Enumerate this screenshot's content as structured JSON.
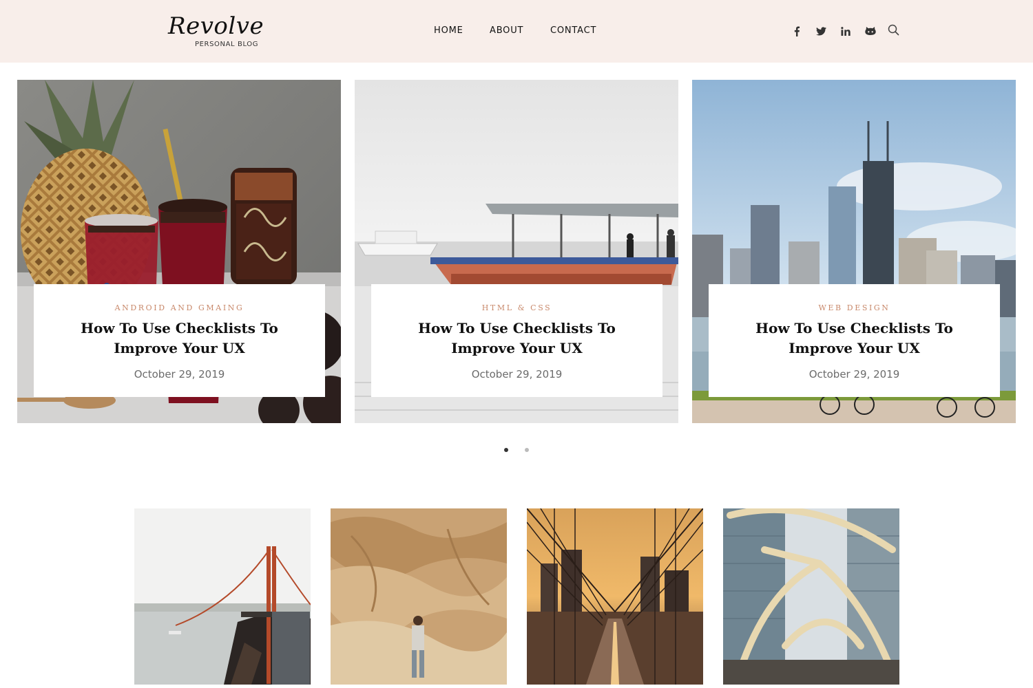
{
  "brand": {
    "name": "Revolve",
    "tagline": "PERSONAL BLOG"
  },
  "nav": {
    "items": [
      "HOME",
      "ABOUT",
      "CONTACT"
    ]
  },
  "social": {
    "icons": [
      "facebook-icon",
      "twitter-icon",
      "linkedin-icon",
      "github-icon",
      "search-icon"
    ]
  },
  "slides": [
    {
      "category": "ANDROID AND GMAING",
      "title": "How To Use Checklists To Improve Your UX",
      "date": "October 29, 2019"
    },
    {
      "category": "HTML & CSS",
      "title": "How To Use Checklists To Improve Your UX",
      "date": "October 29, 2019"
    },
    {
      "category": "WEB DESIGN",
      "title": "How To Use Checklists To Improve Your UX",
      "date": "October 29, 2019"
    }
  ],
  "slider": {
    "page_count": 2,
    "active_page": 1
  },
  "colors": {
    "header_bg": "#f8eeea",
    "category_accent": "#c8886a",
    "active_dot": "#333333",
    "inactive_dot": "#bbbbbb"
  }
}
